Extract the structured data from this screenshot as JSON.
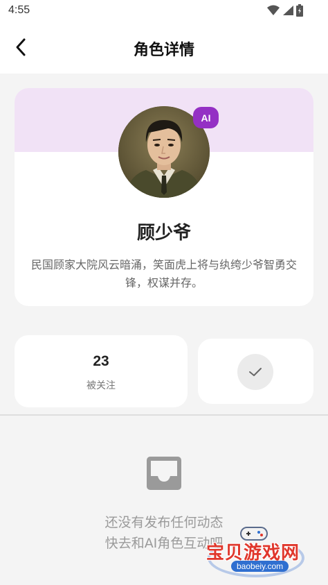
{
  "status_bar": {
    "time": "4:55",
    "icons": [
      "wifi-icon",
      "signal-icon",
      "battery-icon"
    ]
  },
  "header": {
    "title": "角色详情",
    "back_icon": "chevron-left-icon"
  },
  "profile": {
    "ai_badge": "AI",
    "name": "顾少爷",
    "description": "民国顾家大院风云暗涌，笑面虎上将与纨绔少爷智勇交锋，权谋并存。"
  },
  "stats": {
    "followers_count": "23",
    "followers_label": "被关注"
  },
  "follow_button": {
    "icon": "check-icon",
    "state": "followed"
  },
  "empty_state": {
    "icon": "inbox-icon",
    "line1": "还没有发布任何动态",
    "line2": "快去和AI角色互动吧"
  },
  "watermark": {
    "site_name": "宝贝游戏网",
    "domain": "baobeiy.com"
  },
  "colors": {
    "accent": "#9430c4",
    "banner": "#f1e2f6",
    "background": "#f4f4f4",
    "watermark_red": "#e0372c",
    "watermark_blue": "#2f6fd0"
  }
}
